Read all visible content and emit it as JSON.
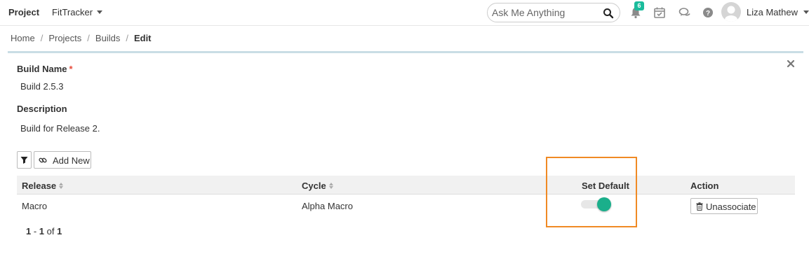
{
  "header": {
    "project_label": "Project",
    "project_selected": "FitTracker",
    "search": {
      "placeholder": "Ask Me Anything"
    },
    "notifications_count": "6",
    "user_name": "Liza Mathew"
  },
  "breadcrumb": {
    "items": [
      "Home",
      "Projects",
      "Builds"
    ],
    "current": "Edit"
  },
  "form": {
    "build_name_label": "Build Name",
    "required_mark": "*",
    "build_name_value": "Build 2.5.3",
    "description_label": "Description",
    "description_value": "Build for Release 2."
  },
  "toolbar": {
    "add_new_label": "Add New"
  },
  "table": {
    "columns": [
      "Release",
      "Cycle",
      "Set Default",
      "Action"
    ],
    "rows": [
      {
        "release": "Macro",
        "cycle": "Alpha Macro",
        "set_default": true,
        "action_label": "Unassociate"
      }
    ]
  },
  "pagination": {
    "from": "1",
    "sep": " - ",
    "to": "1",
    "of": " of ",
    "total": "1"
  },
  "colors": {
    "accent": "#1aaf8b",
    "highlight_border": "#f08a24",
    "divider": "#c9dde5",
    "badge": "#1abc9c"
  }
}
